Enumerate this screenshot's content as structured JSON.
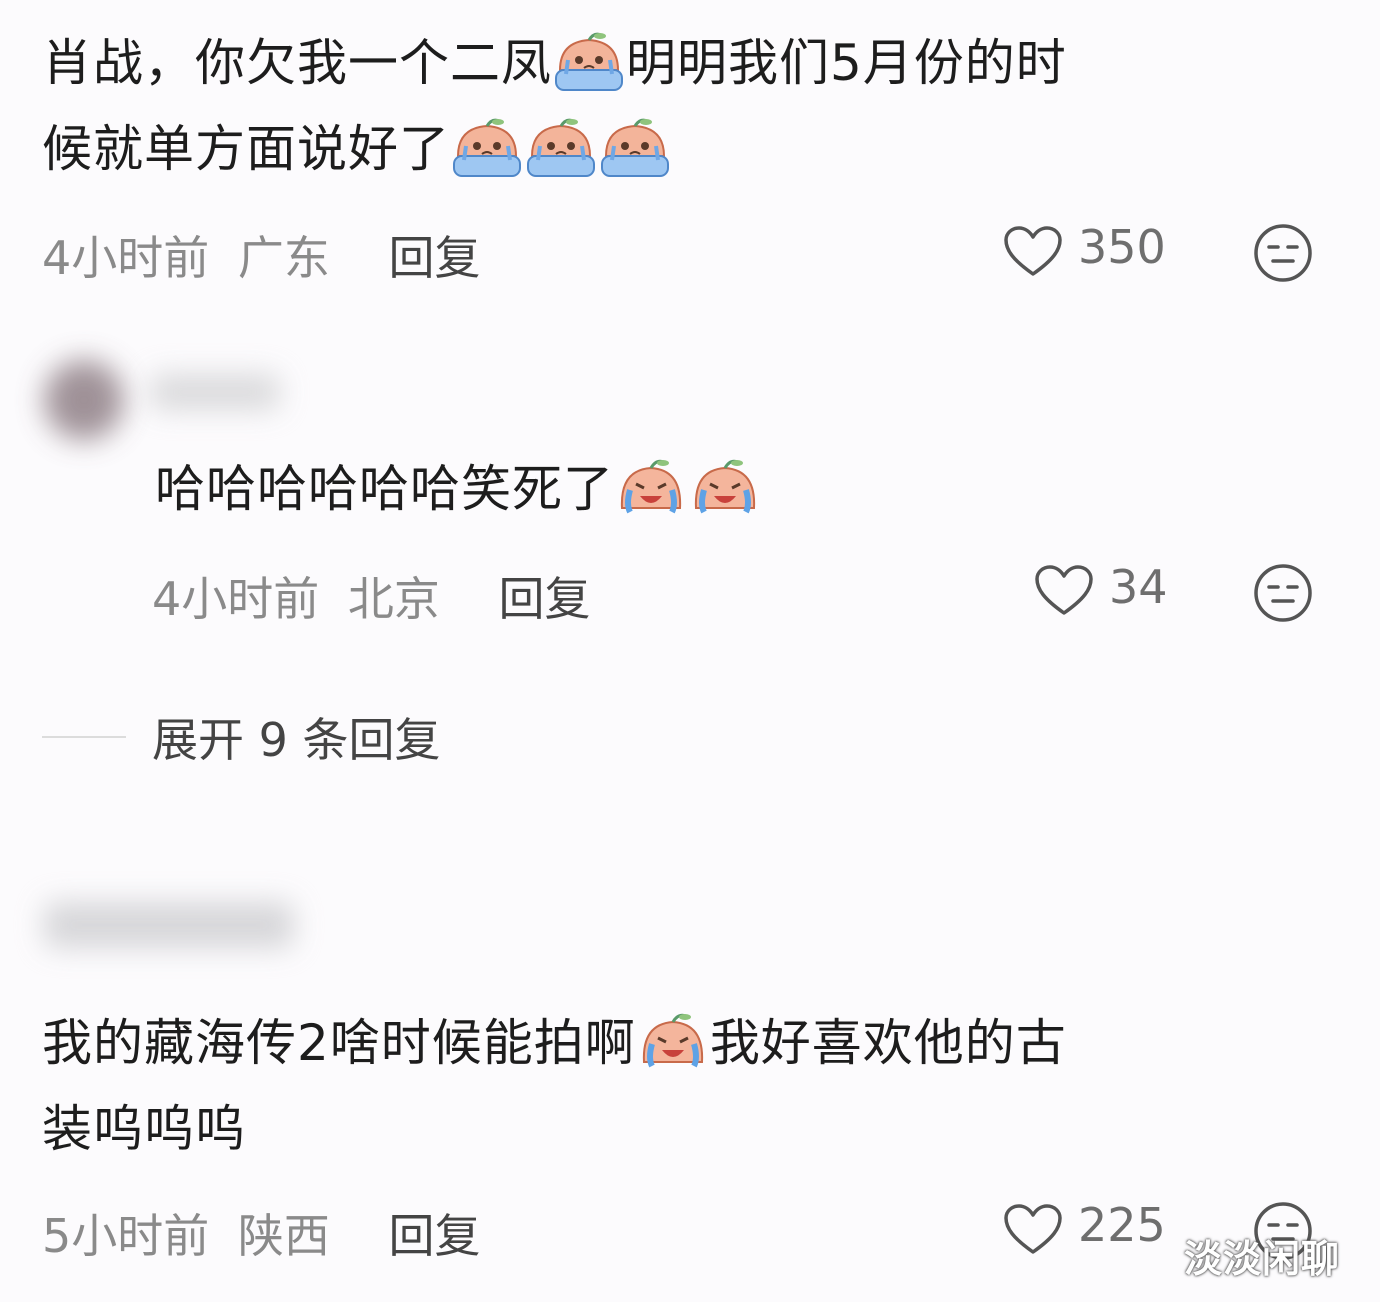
{
  "comments": [
    {
      "line1": "肖战，你欠我一个二凤",
      "line1b": "明明我们5月份的时",
      "line2": "候就单方面说好了",
      "time": "4小时前",
      "location": "广东",
      "reply": "回复",
      "likes": "350"
    },
    {
      "text": "哈哈哈哈哈哈笑死了",
      "time": "4小时前",
      "location": "北京",
      "reply": "回复",
      "likes": "34"
    },
    {
      "line1": "我的藏海传2啥时候能拍啊",
      "line1b": "我好喜欢他的古",
      "line2": "装呜呜呜",
      "time": "5小时前",
      "location": "陕西",
      "reply": "回复",
      "likes": "225"
    }
  ],
  "expand_replies": "展开 9 条回复",
  "watermark": "淡淡闲聊",
  "icons": {
    "like": "heart-outline-icon",
    "react": "expressionless-face-icon",
    "emoji_cry": "crying-peach-sticker",
    "emoji_laugh_cry": "laugh-crying-peach-sticker"
  }
}
